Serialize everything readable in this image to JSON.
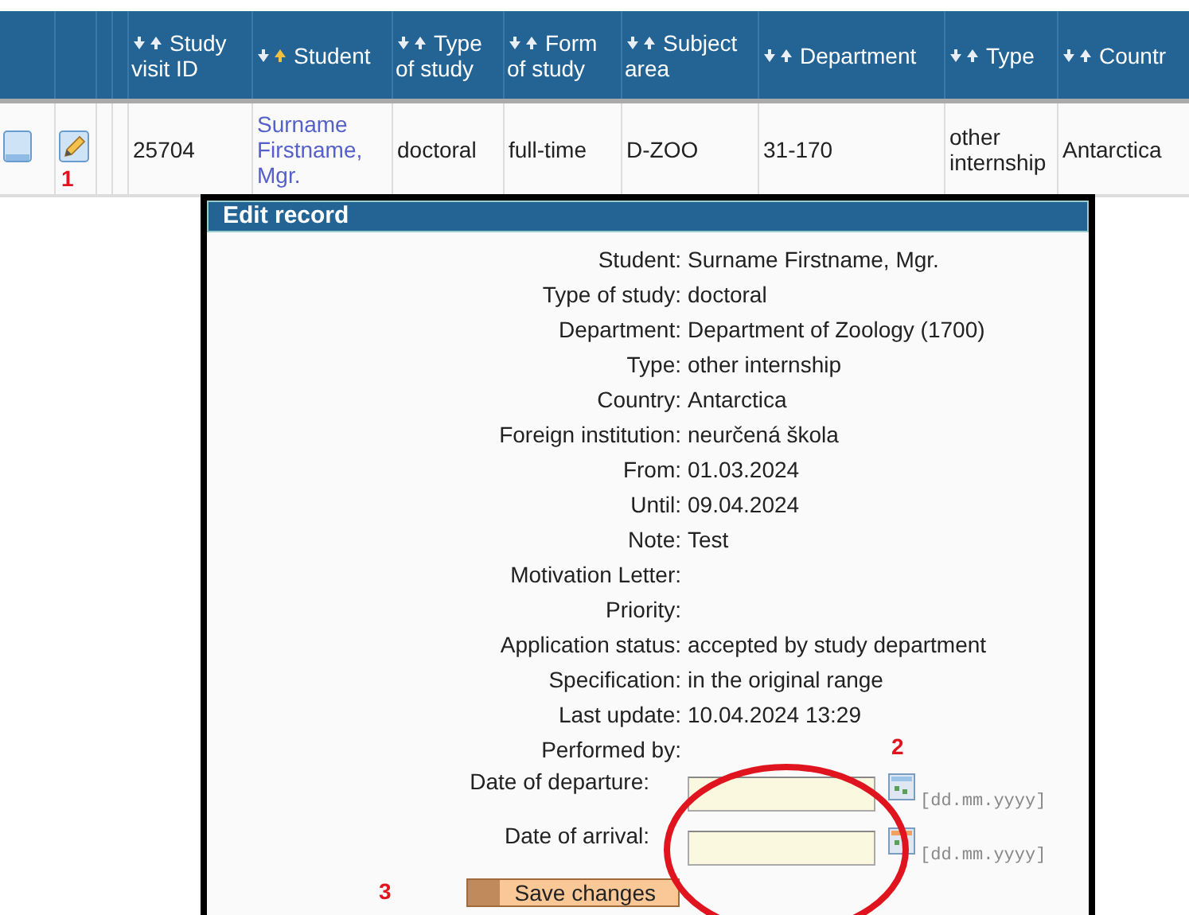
{
  "table": {
    "columns": [
      {
        "kind": "blank"
      },
      {
        "kind": "blank"
      },
      {
        "kind": "blank"
      },
      {
        "kind": "blank"
      },
      {
        "kind": "sortable",
        "label": "Study visit ID",
        "sorted": false
      },
      {
        "kind": "sortable",
        "label": "Student",
        "sorted": true
      },
      {
        "kind": "sortable",
        "label": "Type of study",
        "sorted": false
      },
      {
        "kind": "sortable",
        "label": "Form of study",
        "sorted": false
      },
      {
        "kind": "sortable",
        "label": "Subject area",
        "sorted": false
      },
      {
        "kind": "sortable",
        "label": "Department",
        "sorted": false
      },
      {
        "kind": "sortable",
        "label": "Type",
        "sorted": false
      },
      {
        "kind": "sortable",
        "label": "Countr",
        "sorted": false
      }
    ],
    "rows": [
      {
        "cells": [
          {
            "kind": "view"
          },
          {
            "kind": "edit"
          },
          {
            "kind": "empty"
          },
          {
            "kind": "empty"
          },
          {
            "kind": "text",
            "text": "25704"
          },
          {
            "kind": "link",
            "text": "Surname Firstname, Mgr."
          },
          {
            "kind": "text",
            "text": "doctoral"
          },
          {
            "kind": "text",
            "text": "full-time"
          },
          {
            "kind": "text",
            "text": "D-ZOO"
          },
          {
            "kind": "text",
            "text": "31-170"
          },
          {
            "kind": "text",
            "text": "other internship"
          },
          {
            "kind": "text",
            "text": "Antarctica"
          }
        ]
      }
    ]
  },
  "dialog": {
    "title": "Edit record",
    "fields": [
      {
        "label": "Student:",
        "value": "Surname Firstname, Mgr."
      },
      {
        "label": "Type of study:",
        "value": "doctoral"
      },
      {
        "label": "Department:",
        "value": "Department of Zoology (1700)"
      },
      {
        "label": "Type:",
        "value": "other internship"
      },
      {
        "label": "Country:",
        "value": "Antarctica"
      },
      {
        "label": "Foreign institution:",
        "value": "neurčená škola"
      },
      {
        "label": "From:",
        "value": "01.03.2024"
      },
      {
        "label": "Until:",
        "value": "09.04.2024"
      },
      {
        "label": "Note:",
        "value": "Test"
      },
      {
        "label": "Motivation Letter:"
      },
      {
        "label": "Priority:"
      },
      {
        "label": "Application status:",
        "value": "accepted by study department"
      },
      {
        "label": "Specification:",
        "value": "in the original range"
      },
      {
        "label": "Last update:",
        "value": "10.04.2024 13:29"
      },
      {
        "label": "Performed by:"
      }
    ],
    "date_fields": [
      {
        "label": "Date of departure:",
        "format": "[dd.mm.yyyy]"
      },
      {
        "label": "Date of arrival:",
        "format": "[dd.mm.yyyy]"
      }
    ],
    "save_button": "Save changes"
  },
  "annotations": [
    "1",
    "2",
    "3"
  ]
}
